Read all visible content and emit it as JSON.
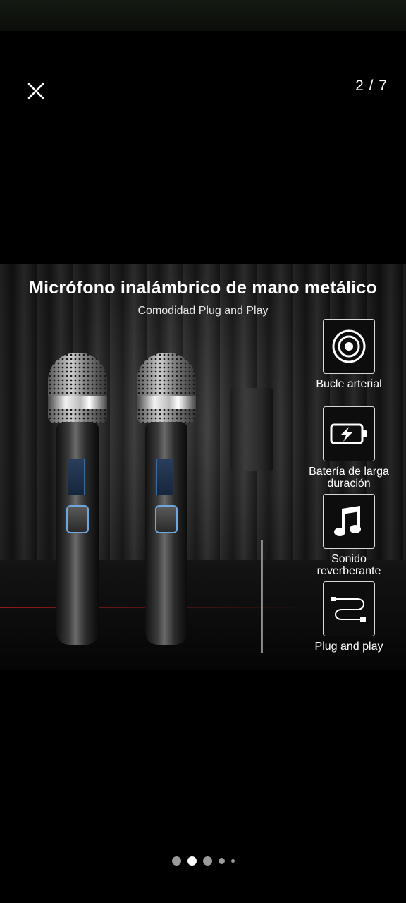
{
  "viewer": {
    "counter": "2 / 7",
    "close_icon": "close-icon"
  },
  "product": {
    "headline": "Micrófono inalámbrico de mano metálico",
    "subline": "Comodidad Plug and Play",
    "features": [
      {
        "label": "Bucle arterial",
        "icon": "concentric-circles-icon"
      },
      {
        "label_line1": "Batería de larga",
        "label_line2": "duración",
        "icon": "battery-charging-icon"
      },
      {
        "label_line1": "Sonido",
        "label_line2": "reverberante",
        "icon": "music-note-icon"
      },
      {
        "label": "Plug and play",
        "icon": "cable-icon"
      }
    ]
  },
  "pagination": {
    "total_visible_dots": 5,
    "active_index": 1
  }
}
